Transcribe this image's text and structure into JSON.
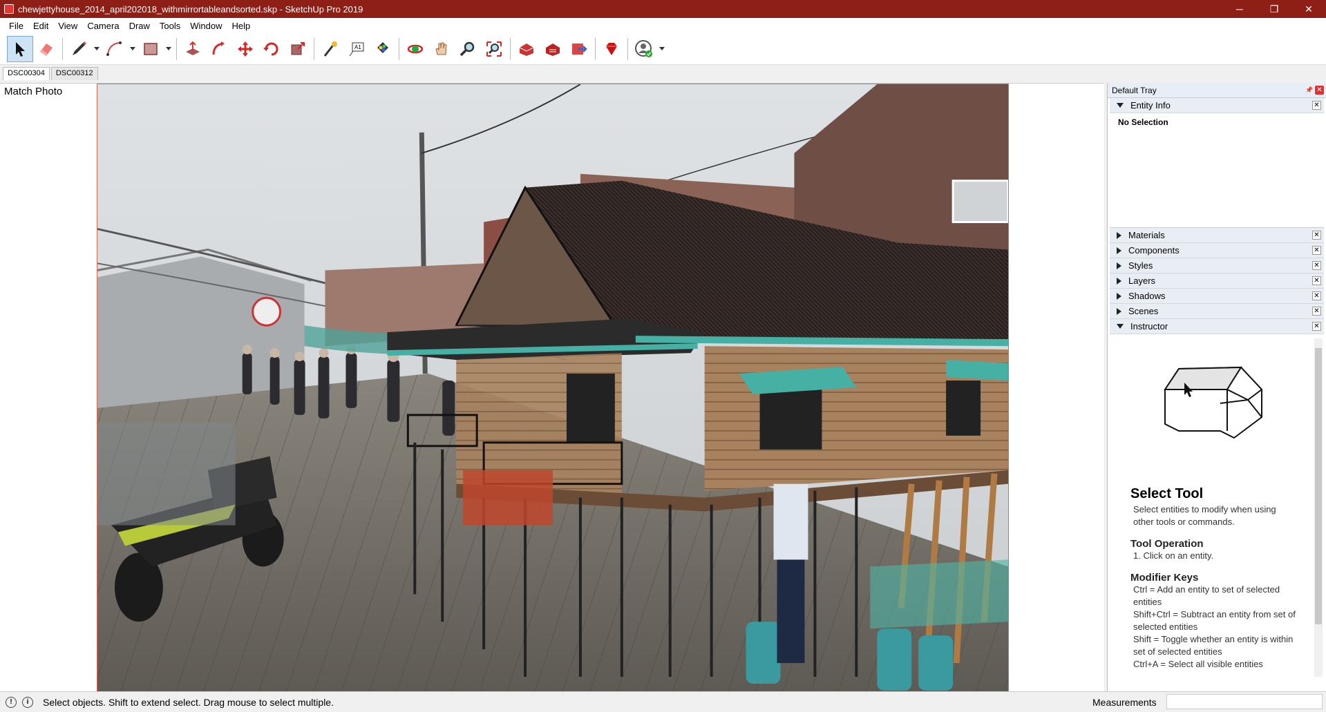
{
  "window": {
    "title": "chewjettyhouse_2014_april202018_withmirrortableandsorted.skp - SketchUp Pro 2019",
    "minimize": "─",
    "maximize": "❐",
    "close": "✕"
  },
  "menu": [
    "File",
    "Edit",
    "View",
    "Camera",
    "Draw",
    "Tools",
    "Window",
    "Help"
  ],
  "scene_tabs": [
    "DSC00304",
    "DSC00312"
  ],
  "viewport": {
    "match_photo_label": "Match Photo"
  },
  "tray": {
    "title": "Default Tray",
    "entity_info": {
      "label": "Entity Info",
      "selection": "No Selection"
    },
    "panels": [
      "Materials",
      "Components",
      "Styles",
      "Layers",
      "Shadows",
      "Scenes"
    ],
    "instructor": {
      "label": "Instructor",
      "tool_title": "Select Tool",
      "tool_desc": "Select entities to modify when using other tools or commands.",
      "op_title": "Tool Operation",
      "op_step": "1. Click on an entity.",
      "mod_title": "Modifier Keys",
      "mod_lines": [
        "Ctrl = Add an entity to set of selected entities",
        "Shift+Ctrl = Subtract an entity from set of selected entities",
        "Shift = Toggle whether an entity is within set of selected entities",
        "Ctrl+A = Select all visible entities"
      ]
    }
  },
  "status": {
    "message": "Select objects. Shift to extend select. Drag mouse to select multiple.",
    "measurements_label": "Measurements"
  },
  "colors": {
    "titlebar": "#8e1f17",
    "selection_tray_header": "#e9eef4"
  }
}
